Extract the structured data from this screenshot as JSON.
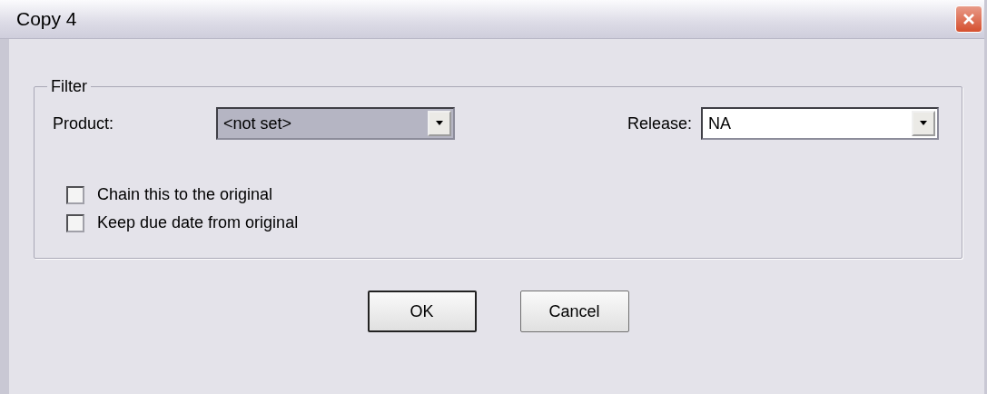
{
  "window": {
    "title": "Copy 4"
  },
  "filter": {
    "title": "Filter",
    "fields": [
      {
        "label": "Product:",
        "value": "<not set>",
        "disabled": true
      },
      {
        "label": "Release:",
        "value": "NA",
        "disabled": false
      }
    ],
    "checkboxes": [
      {
        "label": "Chain this to the original",
        "checked": false
      },
      {
        "label": "Keep due date from original",
        "checked": false
      }
    ]
  },
  "buttons": [
    {
      "label": "OK",
      "default": true
    },
    {
      "label": "Cancel",
      "default": false
    }
  ]
}
